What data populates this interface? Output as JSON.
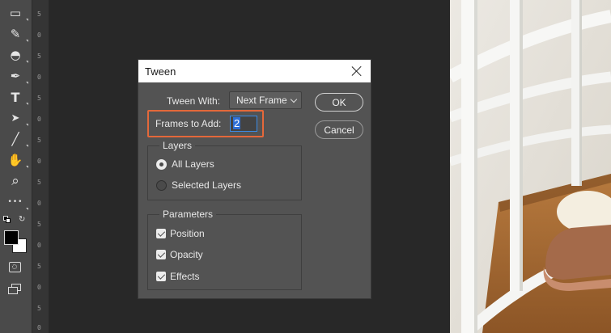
{
  "ruler": {
    "ticks": [
      "5",
      "0",
      "5",
      "0",
      "5",
      "0",
      "5",
      "0",
      "5",
      "0",
      "5",
      "0",
      "5",
      "0",
      "5",
      "0"
    ]
  },
  "tools": [
    {
      "icon": "gradient-tool-icon",
      "glyph": "▭"
    },
    {
      "icon": "smudge-tool-icon",
      "glyph": "✎"
    },
    {
      "icon": "dodge-tool-icon",
      "glyph": "◓"
    },
    {
      "icon": "pen-tool-icon",
      "glyph": "✒"
    },
    {
      "icon": "type-tool-icon",
      "glyph": "T"
    },
    {
      "icon": "path-selection-icon",
      "glyph": "➤"
    },
    {
      "icon": "line-tool-icon",
      "glyph": "╱"
    },
    {
      "icon": "hand-tool-icon",
      "glyph": "✋"
    },
    {
      "icon": "zoom-tool-icon",
      "glyph": "⌕"
    },
    {
      "icon": "more-tools-icon",
      "glyph": "•••"
    }
  ],
  "colors": {
    "foreground": "#000000",
    "background": "#ffffff",
    "accent_highlight": "#e4683a",
    "focus_blue": "#3a8be6"
  },
  "dialog": {
    "title": "Tween",
    "tween_with_label": "Tween With:",
    "tween_with_value": "Next Frame",
    "frames_label": "Frames to Add:",
    "frames_value": "2",
    "ok_label": "OK",
    "cancel_label": "Cancel",
    "layers": {
      "title": "Layers",
      "options": [
        "All Layers",
        "Selected Layers"
      ],
      "selected": "All Layers"
    },
    "parameters": {
      "title": "Parameters",
      "options": [
        "Position",
        "Opacity",
        "Effects"
      ],
      "checked": [
        true,
        true,
        true
      ]
    }
  }
}
